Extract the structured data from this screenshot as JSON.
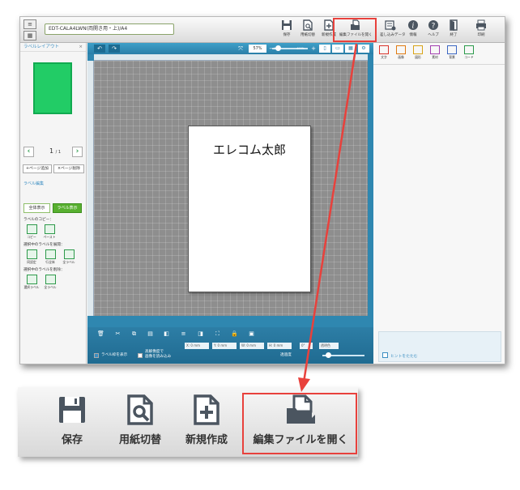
{
  "toolbar": {
    "menu_icon": "menu-icon",
    "filename": "EDT-CALA4LWN(両開き用・上)/A4",
    "buttons": [
      {
        "label": "保存",
        "icon": "save-icon"
      },
      {
        "label": "用紙切替",
        "icon": "paper-switch-icon"
      },
      {
        "label": "新規作成",
        "icon": "new-file-icon"
      },
      {
        "label": "編集ファイルを開く",
        "icon": "open-folder-icon"
      },
      {
        "label": "差し込みデータ",
        "icon": "merge-data-icon"
      },
      {
        "label": "情報",
        "icon": "info-icon"
      },
      {
        "label": "ヘルプ",
        "icon": "help-icon"
      },
      {
        "label": "終了",
        "icon": "exit-icon"
      },
      {
        "label": "印刷",
        "icon": "print-icon"
      }
    ]
  },
  "left_panel": {
    "title": "ラベルレイアウト",
    "close": "×",
    "page_current": "1",
    "page_total": "/ 1",
    "add_page": "+ページ追加",
    "delete_page": "×ページ削除",
    "label_edit_title": "ラベル編集",
    "view_all": "全体表示",
    "view_label": "ラベル表示",
    "copy_title": "ラベルのコピー：",
    "copy_label": "コピー",
    "paste_label": "ペースト",
    "expand_title": "選択中のラベルを展開：",
    "expand_buttons": [
      "同設定",
      "行全体",
      "全ラベル"
    ],
    "delete_title": "選択中のラベルを削除：",
    "delete_buttons": [
      "選択ラベル",
      "全ラベル"
    ]
  },
  "canvas": {
    "zoom_value": "57%",
    "zoom_min": "25%",
    "zoom_max": "400%",
    "label_text": "エレコム太郎",
    "x_label": "X:",
    "x_value": "0 mm",
    "y_label": "Y:",
    "y_value": "0 mm",
    "w_label": "W:",
    "w_value": "0 mm",
    "h_label": "H:",
    "h_value": "0 mm",
    "rotation": "0°",
    "transparency": "透明色",
    "opacity": "透過度",
    "show_frame": "ラベル枠を表示",
    "hires_line1": "高解像度で",
    "hires_line2": "画像を読み込み"
  },
  "right_panel": {
    "tools": [
      {
        "label": "文字",
        "color": "#d9342b"
      },
      {
        "label": "画像",
        "color": "#e07a12"
      },
      {
        "label": "図形",
        "color": "#d8a316"
      },
      {
        "label": "素材",
        "color": "#a23fb0"
      },
      {
        "label": "背景",
        "color": "#3b66c2"
      },
      {
        "label": "コード",
        "color": "#2a9a4a"
      }
    ],
    "hint_label": "ヒントをたたむ"
  },
  "zoomed_toolbar": {
    "buttons": [
      {
        "label": "保存",
        "icon": "save-icon"
      },
      {
        "label": "用紙切替",
        "icon": "paper-switch-icon"
      },
      {
        "label": "新規作成",
        "icon": "new-file-icon"
      },
      {
        "label": "編集ファイルを開く",
        "icon": "open-folder-icon"
      }
    ]
  },
  "colors": {
    "highlight": "#e8413c",
    "label_green": "#22cc66",
    "canvas_blue": "#2f87b0"
  }
}
